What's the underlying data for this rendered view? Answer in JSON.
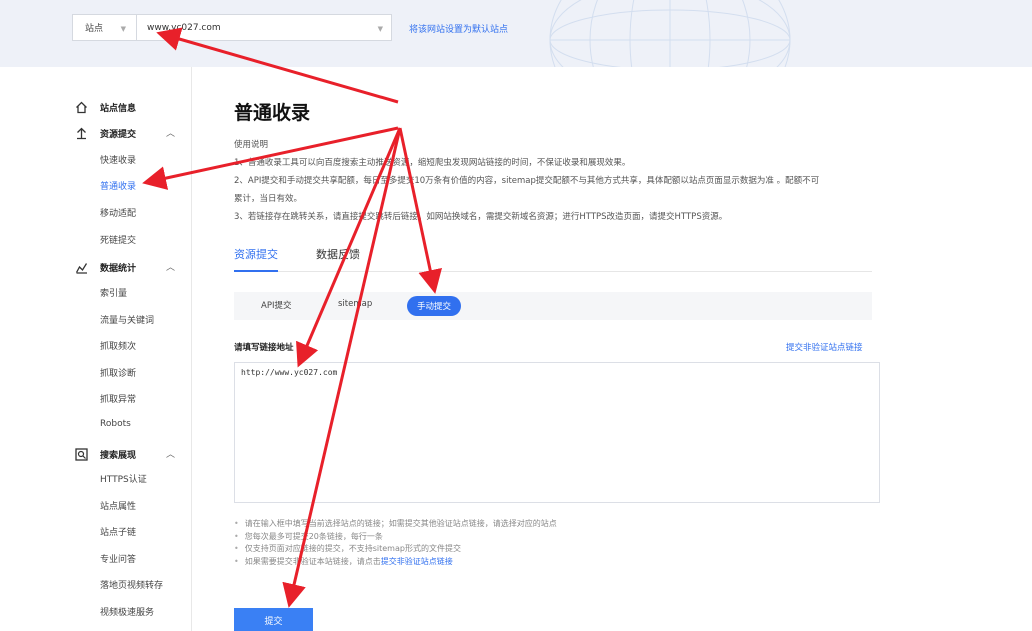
{
  "header": {
    "site_label": "站点",
    "site_value": "www.yc027.com",
    "set_default_link": "将该网站设置为默认站点"
  },
  "sidebar": {
    "groups": [
      {
        "label": "站点信息",
        "icon": "home-icon",
        "items": []
      },
      {
        "label": "资源提交",
        "icon": "submit-icon",
        "items": [
          "快速收录",
          "普通收录",
          "移动适配",
          "死链提交"
        ],
        "active_item": "普通收录"
      },
      {
        "label": "数据统计",
        "icon": "chart-icon",
        "items": [
          "索引量",
          "流量与关键词",
          "抓取频次",
          "抓取诊断",
          "抓取异常",
          "Robots"
        ]
      },
      {
        "label": "搜索展现",
        "icon": "search-display-icon",
        "items": [
          "HTTPS认证",
          "站点属性",
          "站点子链",
          "专业问答",
          "落地页视频转存",
          "视频极速服务"
        ]
      }
    ]
  },
  "main": {
    "title": "普通收录",
    "usage_heading": "使用说明",
    "usage_lines": [
      "1、普通收录工具可以向百度搜索主动推送资源，缩短爬虫发现网站链接的时间，不保证收录和展现效果。",
      "2、API提交和手动提交共享配额，每日至多提交10万条有价值的内容，sitemap提交配额不与其他方式共享，具体配额以站点页面显示数据为准 。配额不可",
      "累计，当日有效。",
      "3、若链接存在跳转关系，请直接提交跳转后链接。如网站换域名，需提交新域名资源；进行HTTPS改造页面，请提交HTTPS资源。"
    ],
    "tabs": [
      "资源提交",
      "数据反馈"
    ],
    "active_tab": "资源提交",
    "subtabs": [
      "API提交",
      "sitemap",
      "手动提交"
    ],
    "active_subtab": "手动提交",
    "field_label": "请填写链接地址",
    "nonverified_link": "提交非验证站点链接",
    "textarea_value": "http://www.yc027.com",
    "notes": [
      "请在输入框中填写当前选择站点的链接；如需提交其他验证站点链接，请选择对应的站点",
      "您每次最多可提交20条链接，每行一条",
      "仅支持页面对应链接的提交，不支持sitemap形式的文件提交"
    ],
    "note_last_prefix": "如果需要提交非验证本站链接，请点击",
    "note_last_link": "提交非验证站点链接",
    "submit_label": "提交"
  },
  "colors": {
    "accent": "#3170ef",
    "arrow": "#e8202a",
    "top_band": "#eef1f8"
  }
}
